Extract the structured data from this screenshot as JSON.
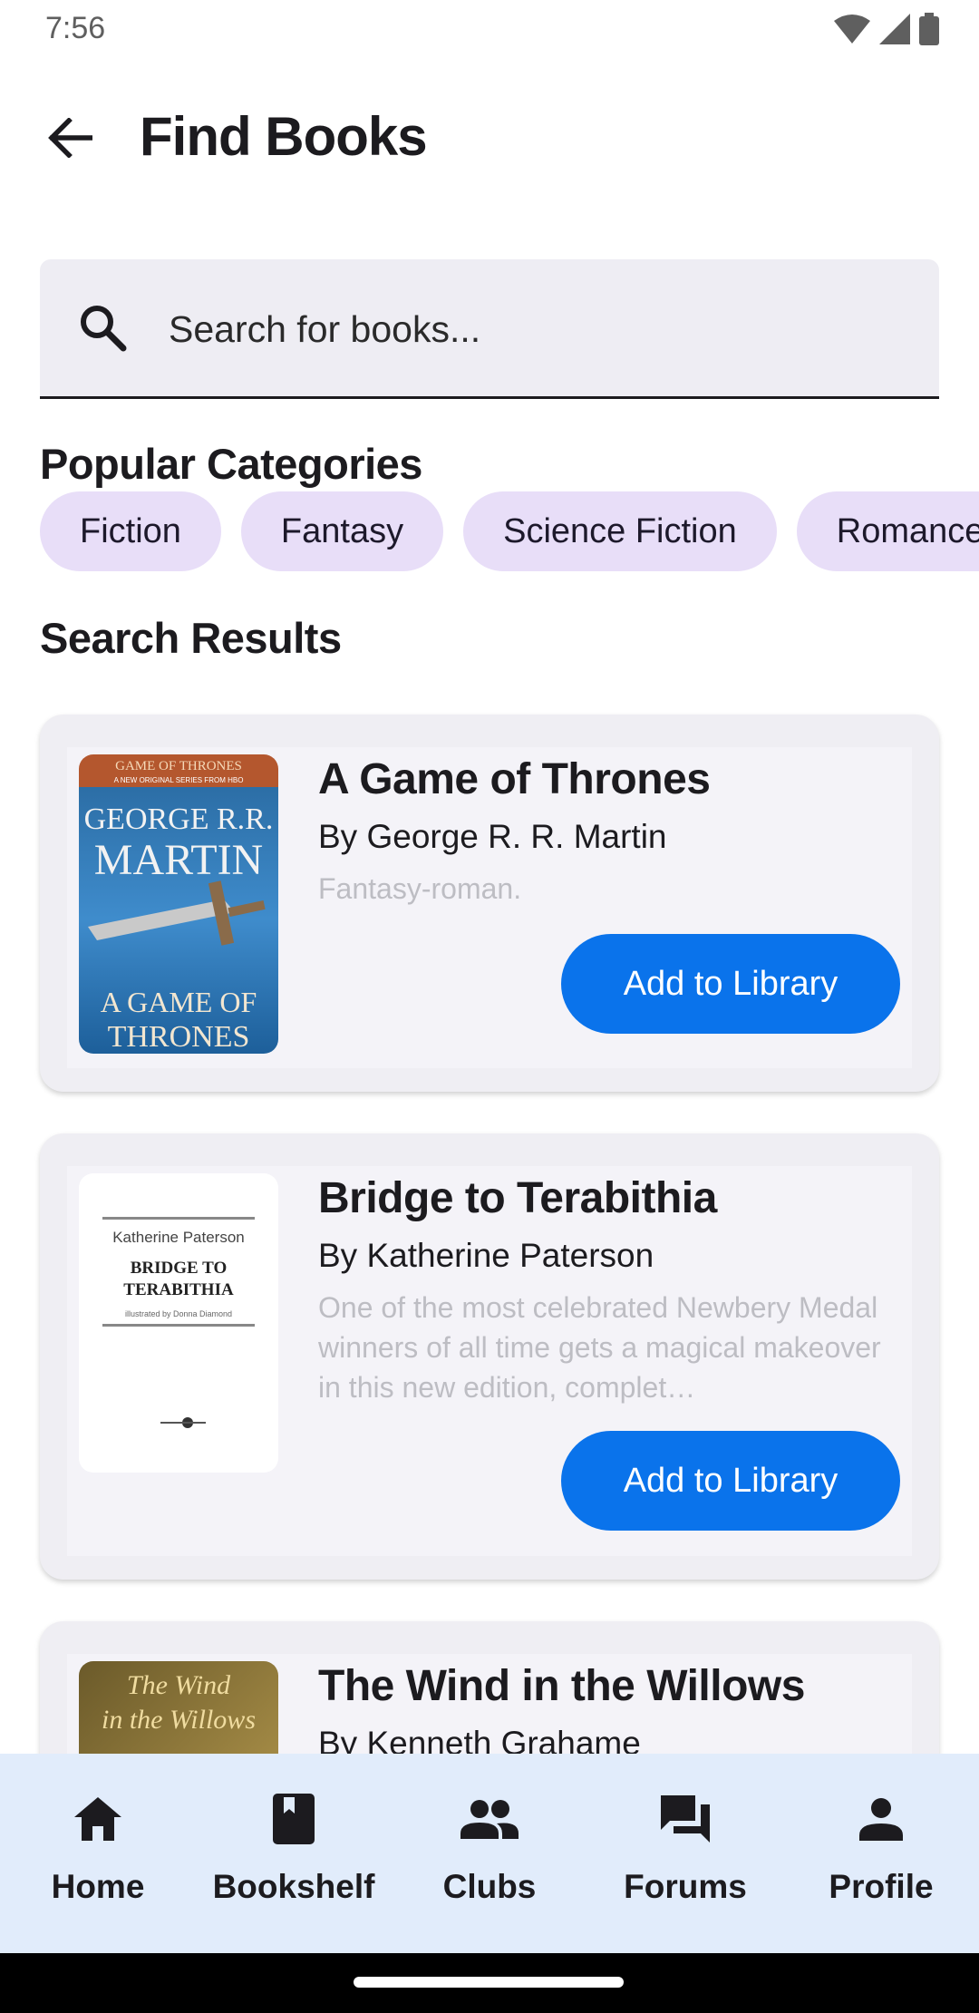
{
  "status_bar": {
    "time": "7:56"
  },
  "app_bar": {
    "title": "Find Books"
  },
  "search": {
    "placeholder": "Search for books...",
    "value": ""
  },
  "categories": {
    "title": "Popular Categories",
    "chips": [
      "Fiction",
      "Fantasy",
      "Science Fiction",
      "Romance"
    ]
  },
  "results": {
    "title": "Search Results",
    "books": [
      {
        "title": "A Game of Thrones",
        "author": "By George R. R. Martin",
        "description": "Fantasy-roman.",
        "button": "Add to Library",
        "cover_text": [
          "GAME OF THRONES",
          "A NEW ORIGINAL SERIES FROM HBO",
          "GEORGE R.R.",
          "MARTIN",
          "A GAME OF",
          "THRONES"
        ]
      },
      {
        "title": "Bridge to Terabithia",
        "author": "By Katherine Paterson",
        "description": "One of the most celebrated Newbery Medal winners of all time gets a magical makeover in this new edition, complet…",
        "button": "Add to Library",
        "cover_text": [
          "Katherine Paterson",
          "BRIDGE TO",
          "TERABITHIA",
          "illustrated by Donna Diamond"
        ]
      },
      {
        "title": "The Wind in the Willows",
        "author": "By Kenneth Grahame",
        "cover_text": [
          "The Wind",
          "in the Willows"
        ]
      }
    ]
  },
  "bottom_nav": {
    "items": [
      {
        "label": "Home",
        "icon": "home-icon"
      },
      {
        "label": "Bookshelf",
        "icon": "book-icon"
      },
      {
        "label": "Clubs",
        "icon": "people-icon"
      },
      {
        "label": "Forums",
        "icon": "forum-icon"
      },
      {
        "label": "Profile",
        "icon": "person-icon"
      }
    ]
  },
  "colors": {
    "accent_button": "#0a73eb",
    "chip_bg": "#e8def8",
    "nav_bg": "#e1ecfb",
    "card_bg": "#efeef3"
  }
}
